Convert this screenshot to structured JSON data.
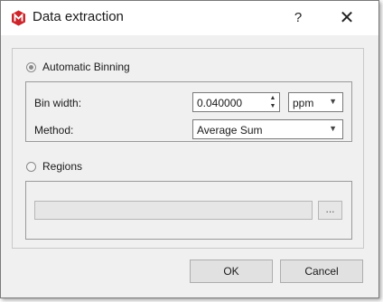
{
  "window": {
    "title": "Data extraction",
    "help_glyph": "?",
    "close_glyph": "✕",
    "icon": "app-logo-icon",
    "icon_color": "#c8282d"
  },
  "automatic_binning": {
    "label": "Automatic Binning",
    "selected": true,
    "bin_width": {
      "label": "Bin width:",
      "value": "0.040000",
      "unit": "ppm",
      "up_glyph": "▲",
      "down_glyph": "▼"
    },
    "method": {
      "label": "Method:",
      "value": "Average Sum",
      "arrow": "▼"
    }
  },
  "regions": {
    "label": "Regions",
    "selected": false,
    "path_value": "",
    "browse_label": "..."
  },
  "buttons": {
    "ok": "OK",
    "cancel": "Cancel"
  }
}
